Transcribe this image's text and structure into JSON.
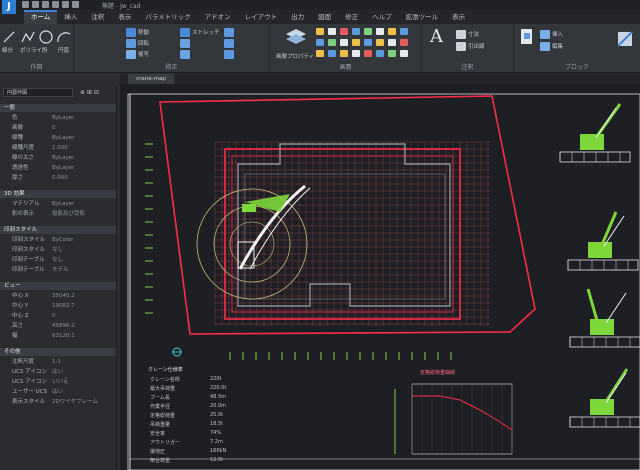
{
  "app": {
    "logo_letter": "J",
    "title": "無題 - Jw_cad"
  },
  "tabs": [
    {
      "label": "ホーム",
      "active": true
    },
    {
      "label": "挿入",
      "active": false
    },
    {
      "label": "注釈",
      "active": false
    },
    {
      "label": "表示",
      "active": false
    },
    {
      "label": "パラメトリック",
      "active": false
    },
    {
      "label": "アドオン",
      "active": false
    },
    {
      "label": "レイアウト",
      "active": false
    },
    {
      "label": "出力",
      "active": false
    },
    {
      "label": "図面",
      "active": false
    },
    {
      "label": "修正",
      "active": false
    },
    {
      "label": "ヘルプ",
      "active": false
    },
    {
      "label": "拡張ツール",
      "active": false
    },
    {
      "label": "表示",
      "active": false
    }
  ],
  "ribbon": {
    "groups": [
      {
        "label": "作図"
      },
      {
        "label": "修正"
      },
      {
        "label": "画層"
      },
      {
        "label": "注釈"
      },
      {
        "label": "ブロック"
      }
    ],
    "draw_tools": [
      "線分",
      "ポリライン",
      "円",
      "円弧"
    ],
    "modify_items": [
      "移動",
      "回転",
      "複写",
      "ストレッチ"
    ],
    "layer_items": [
      "画層プロパティ"
    ],
    "annot_big": "A",
    "annot_items": [
      "寸法",
      "引出線"
    ],
    "block_items": [
      "挿入",
      "編集"
    ]
  },
  "filetab": {
    "label": "crane-map"
  },
  "properties": {
    "header": "円弧作図",
    "sections": [
      {
        "title": "一般",
        "rows": [
          {
            "k": "色",
            "v": "ByLayer"
          },
          {
            "k": "画層",
            "v": "0"
          },
          {
            "k": "線種",
            "v": "ByLayer"
          },
          {
            "k": "線種尺度",
            "v": "1.000"
          },
          {
            "k": "線の太さ",
            "v": "ByLayer"
          },
          {
            "k": "透過性",
            "v": "ByLayer"
          },
          {
            "k": "厚さ",
            "v": "0.000"
          }
        ]
      },
      {
        "title": "3D 効果",
        "rows": [
          {
            "k": "マテリアル",
            "v": "ByLayer"
          },
          {
            "k": "影の表示",
            "v": "投影及び受影"
          }
        ]
      },
      {
        "title": "印刻スタイル",
        "rows": [
          {
            "k": "印刻スタイル",
            "v": "ByColor"
          },
          {
            "k": "印刻スタイル",
            "v": "なし"
          },
          {
            "k": "印刻テーブル",
            "v": "なし"
          },
          {
            "k": "印刻テーブル",
            "v": "モデル"
          }
        ]
      },
      {
        "title": "ビュー",
        "rows": [
          {
            "k": "中心 X",
            "v": "35040.2"
          },
          {
            "k": "中心 Y",
            "v": "19082.7"
          },
          {
            "k": "中心 Z",
            "v": "0"
          },
          {
            "k": "高さ",
            "v": "45896.2"
          },
          {
            "k": "幅",
            "v": "63120.1"
          }
        ]
      },
      {
        "title": "その他",
        "rows": [
          {
            "k": "注釈尺度",
            "v": "1:1"
          },
          {
            "k": "UCS アイコン",
            "v": "はい"
          },
          {
            "k": "UCS アイコン",
            "v": "いいえ"
          },
          {
            "k": "ユーザー UCS",
            "v": "はい"
          },
          {
            "k": "表示スタイル",
            "v": "2Dワイヤフレーム"
          }
        ]
      }
    ]
  },
  "canvas": {
    "table_title": "クレーン仕様表",
    "table_rows": [
      [
        "クレーン名称",
        "220t"
      ],
      [
        "最大吊荷重",
        "220.0t"
      ],
      [
        "ブーム長",
        "48.5m"
      ],
      [
        "作業半径",
        "20.0m"
      ],
      [
        "定格総荷重",
        "25.0t"
      ],
      [
        "吊荷重量",
        "18.5t"
      ],
      [
        "安全率",
        "74%"
      ],
      [
        "アウトリガー",
        "7.2m"
      ],
      [
        "接地圧",
        "160kN"
      ],
      [
        "架台荷重",
        "12.5t"
      ]
    ],
    "graph_title": "定格総荷重曲線"
  },
  "colors": {
    "bg": "#1d1f24",
    "boundary": "#ff2d46",
    "grid": "#ff5a73",
    "building": "#8a8f96",
    "crane": "#7dd63a",
    "cyan": "#3ad6e0"
  }
}
